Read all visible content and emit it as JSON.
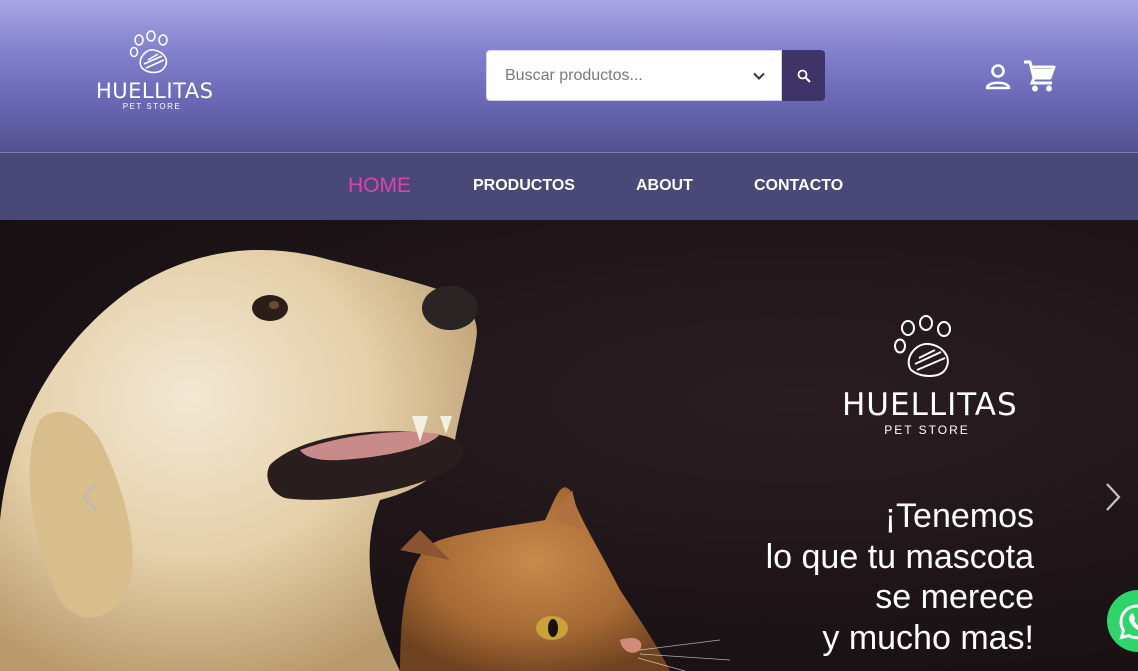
{
  "header": {
    "logo": {
      "name": "HUELLITAS",
      "subtitle": "PET STORE"
    },
    "search": {
      "placeholder": "Buscar productos..."
    }
  },
  "nav": {
    "items": [
      {
        "label": "HOME",
        "active": true
      },
      {
        "label": "PRODUCTOS",
        "active": false
      },
      {
        "label": "ABOUT",
        "active": false
      },
      {
        "label": "CONTACTO",
        "active": false
      }
    ]
  },
  "hero": {
    "logo": {
      "name": "HUELLITAS",
      "subtitle": "PET STORE"
    },
    "tagline": [
      "¡Tenemos",
      "lo que tu mascota",
      "se merece",
      "y mucho mas!"
    ]
  },
  "colors": {
    "header_top": "#a9a6e3",
    "header_bottom": "#54528f",
    "nav_bg": "#4a4876",
    "accent_active": "#e03fb2",
    "search_button": "#3e3467",
    "hero_bg": "#1c1316",
    "whatsapp": "#2fd46a"
  },
  "icons": [
    "paw-icon",
    "chevron-down-icon",
    "search-icon",
    "user-icon",
    "cart-icon",
    "chevron-left-icon",
    "chevron-right-icon",
    "whatsapp-icon"
  ]
}
